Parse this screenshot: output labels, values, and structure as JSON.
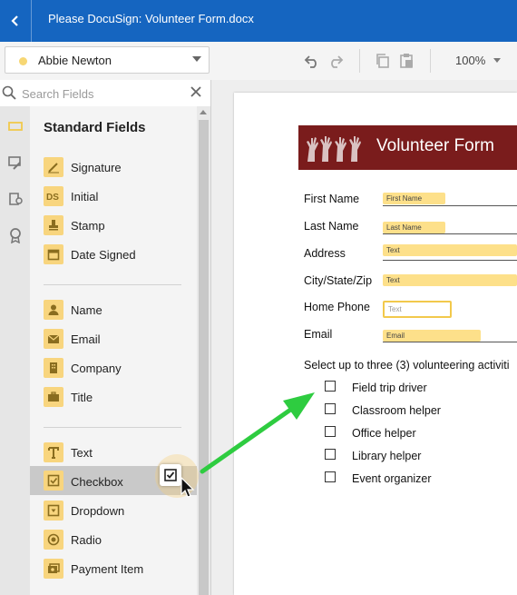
{
  "header": {
    "title": "Please DocuSign: Volunteer Form.docx"
  },
  "toolbar": {
    "recipient": "Abbie Newton",
    "recipient_color": "#f7d774",
    "zoom": "100%"
  },
  "search": {
    "placeholder": "Search Fields"
  },
  "panel": {
    "heading": "Standard Fields",
    "groups": [
      [
        "Signature",
        "Initial",
        "Stamp",
        "Date Signed"
      ],
      [
        "Name",
        "Email",
        "Company",
        "Title"
      ],
      [
        "Text",
        "Checkbox",
        "Dropdown",
        "Radio",
        "Payment Item"
      ]
    ],
    "active_item": "Checkbox"
  },
  "document": {
    "banner_title": "Volunteer Form",
    "banner_color": "#7a1c1c",
    "fields": [
      {
        "label": "First Name",
        "tag": "First Name"
      },
      {
        "label": "Last Name",
        "tag": "Last Name"
      },
      {
        "label": "Address",
        "tag": "Text"
      },
      {
        "label": "City/State/Zip",
        "tag": "Text"
      },
      {
        "label": "Home Phone",
        "tag": "Text"
      },
      {
        "label": "Email",
        "tag": "Email"
      }
    ],
    "prompt": "Select up to three (3) volunteering activiti",
    "options": [
      "Field trip driver",
      "Classroom helper",
      "Office helper",
      "Library helper",
      "Event organizer"
    ]
  },
  "colors": {
    "accent": "#1565c0",
    "tag": "#fde08a",
    "arrow": "#2ecc40"
  }
}
